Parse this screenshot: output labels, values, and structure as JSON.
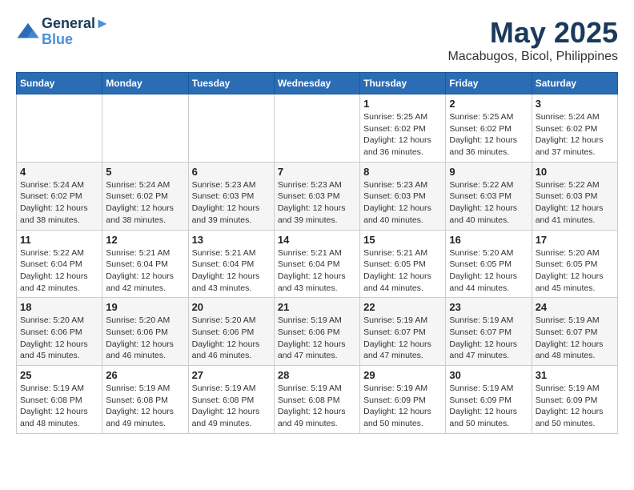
{
  "header": {
    "logo_line1": "General",
    "logo_line2": "Blue",
    "month": "May 2025",
    "location": "Macabugos, Bicol, Philippines"
  },
  "weekdays": [
    "Sunday",
    "Monday",
    "Tuesday",
    "Wednesday",
    "Thursday",
    "Friday",
    "Saturday"
  ],
  "weeks": [
    [
      {
        "day": "",
        "info": ""
      },
      {
        "day": "",
        "info": ""
      },
      {
        "day": "",
        "info": ""
      },
      {
        "day": "",
        "info": ""
      },
      {
        "day": "1",
        "info": "Sunrise: 5:25 AM\nSunset: 6:02 PM\nDaylight: 12 hours\nand 36 minutes."
      },
      {
        "day": "2",
        "info": "Sunrise: 5:25 AM\nSunset: 6:02 PM\nDaylight: 12 hours\nand 36 minutes."
      },
      {
        "day": "3",
        "info": "Sunrise: 5:24 AM\nSunset: 6:02 PM\nDaylight: 12 hours\nand 37 minutes."
      }
    ],
    [
      {
        "day": "4",
        "info": "Sunrise: 5:24 AM\nSunset: 6:02 PM\nDaylight: 12 hours\nand 38 minutes."
      },
      {
        "day": "5",
        "info": "Sunrise: 5:24 AM\nSunset: 6:02 PM\nDaylight: 12 hours\nand 38 minutes."
      },
      {
        "day": "6",
        "info": "Sunrise: 5:23 AM\nSunset: 6:03 PM\nDaylight: 12 hours\nand 39 minutes."
      },
      {
        "day": "7",
        "info": "Sunrise: 5:23 AM\nSunset: 6:03 PM\nDaylight: 12 hours\nand 39 minutes."
      },
      {
        "day": "8",
        "info": "Sunrise: 5:23 AM\nSunset: 6:03 PM\nDaylight: 12 hours\nand 40 minutes."
      },
      {
        "day": "9",
        "info": "Sunrise: 5:22 AM\nSunset: 6:03 PM\nDaylight: 12 hours\nand 40 minutes."
      },
      {
        "day": "10",
        "info": "Sunrise: 5:22 AM\nSunset: 6:03 PM\nDaylight: 12 hours\nand 41 minutes."
      }
    ],
    [
      {
        "day": "11",
        "info": "Sunrise: 5:22 AM\nSunset: 6:04 PM\nDaylight: 12 hours\nand 42 minutes."
      },
      {
        "day": "12",
        "info": "Sunrise: 5:21 AM\nSunset: 6:04 PM\nDaylight: 12 hours\nand 42 minutes."
      },
      {
        "day": "13",
        "info": "Sunrise: 5:21 AM\nSunset: 6:04 PM\nDaylight: 12 hours\nand 43 minutes."
      },
      {
        "day": "14",
        "info": "Sunrise: 5:21 AM\nSunset: 6:04 PM\nDaylight: 12 hours\nand 43 minutes."
      },
      {
        "day": "15",
        "info": "Sunrise: 5:21 AM\nSunset: 6:05 PM\nDaylight: 12 hours\nand 44 minutes."
      },
      {
        "day": "16",
        "info": "Sunrise: 5:20 AM\nSunset: 6:05 PM\nDaylight: 12 hours\nand 44 minutes."
      },
      {
        "day": "17",
        "info": "Sunrise: 5:20 AM\nSunset: 6:05 PM\nDaylight: 12 hours\nand 45 minutes."
      }
    ],
    [
      {
        "day": "18",
        "info": "Sunrise: 5:20 AM\nSunset: 6:06 PM\nDaylight: 12 hours\nand 45 minutes."
      },
      {
        "day": "19",
        "info": "Sunrise: 5:20 AM\nSunset: 6:06 PM\nDaylight: 12 hours\nand 46 minutes."
      },
      {
        "day": "20",
        "info": "Sunrise: 5:20 AM\nSunset: 6:06 PM\nDaylight: 12 hours\nand 46 minutes."
      },
      {
        "day": "21",
        "info": "Sunrise: 5:19 AM\nSunset: 6:06 PM\nDaylight: 12 hours\nand 47 minutes."
      },
      {
        "day": "22",
        "info": "Sunrise: 5:19 AM\nSunset: 6:07 PM\nDaylight: 12 hours\nand 47 minutes."
      },
      {
        "day": "23",
        "info": "Sunrise: 5:19 AM\nSunset: 6:07 PM\nDaylight: 12 hours\nand 47 minutes."
      },
      {
        "day": "24",
        "info": "Sunrise: 5:19 AM\nSunset: 6:07 PM\nDaylight: 12 hours\nand 48 minutes."
      }
    ],
    [
      {
        "day": "25",
        "info": "Sunrise: 5:19 AM\nSunset: 6:08 PM\nDaylight: 12 hours\nand 48 minutes."
      },
      {
        "day": "26",
        "info": "Sunrise: 5:19 AM\nSunset: 6:08 PM\nDaylight: 12 hours\nand 49 minutes."
      },
      {
        "day": "27",
        "info": "Sunrise: 5:19 AM\nSunset: 6:08 PM\nDaylight: 12 hours\nand 49 minutes."
      },
      {
        "day": "28",
        "info": "Sunrise: 5:19 AM\nSunset: 6:08 PM\nDaylight: 12 hours\nand 49 minutes."
      },
      {
        "day": "29",
        "info": "Sunrise: 5:19 AM\nSunset: 6:09 PM\nDaylight: 12 hours\nand 50 minutes."
      },
      {
        "day": "30",
        "info": "Sunrise: 5:19 AM\nSunset: 6:09 PM\nDaylight: 12 hours\nand 50 minutes."
      },
      {
        "day": "31",
        "info": "Sunrise: 5:19 AM\nSunset: 6:09 PM\nDaylight: 12 hours\nand 50 minutes."
      }
    ]
  ]
}
